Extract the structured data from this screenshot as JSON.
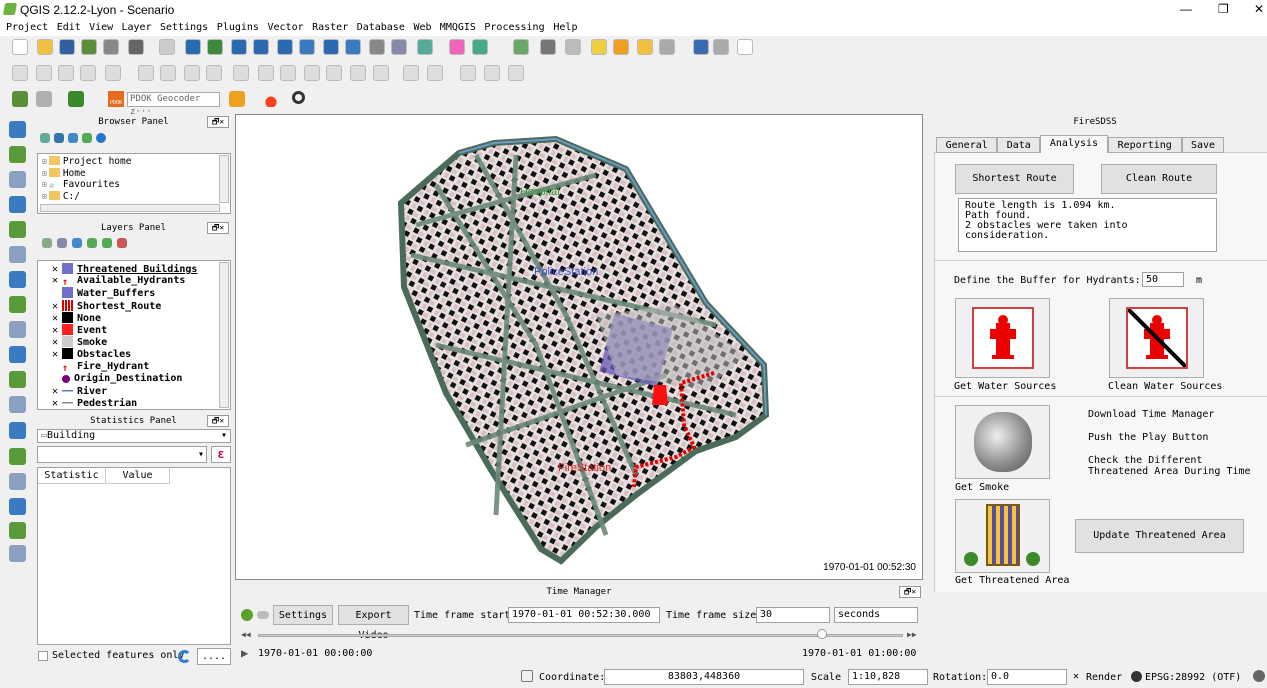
{
  "window": {
    "title": "QGIS 2.12.2-Lyon - Scenario",
    "min": "—",
    "max": "❐",
    "close": "✕"
  },
  "menu": [
    "Project",
    "Edit",
    "View",
    "Layer",
    "Settings",
    "Plugins",
    "Vector",
    "Raster",
    "Database",
    "Web",
    "MMQGIS",
    "Processing",
    "Help"
  ],
  "toolbar3": {
    "geocoder_placeholder": "PDOK Geocoder z···",
    "pdok_label": "PDOK"
  },
  "browser": {
    "title": "Browser Panel",
    "items": [
      "Project home",
      "Home",
      "Favourites",
      "C:/"
    ]
  },
  "layers": {
    "title": "Layers Panel",
    "items": [
      {
        "name": "Threatened Buildings",
        "checked": "✕",
        "color": "#7070c8",
        "underline": true
      },
      {
        "name": "Available_Hydrants",
        "checked": "✕",
        "color": "#e00000",
        "type": "hydrant"
      },
      {
        "name": "Water_Buffers",
        "checked": "",
        "color": "#7070c8"
      },
      {
        "name": "Shortest_Route",
        "checked": "✕",
        "color": "#e00000",
        "type": "route"
      },
      {
        "name": "None",
        "checked": "✕",
        "color": "#000000"
      },
      {
        "name": "Event",
        "checked": "✕",
        "color": "#ff2020"
      },
      {
        "name": "Smoke",
        "checked": "✕",
        "color": "#cccccc"
      },
      {
        "name": "Obstacles",
        "checked": "✕",
        "color": "#000000"
      },
      {
        "name": "Fire_Hydrant",
        "checked": "",
        "color": "#e00000",
        "type": "hydrant"
      },
      {
        "name": "Origin_Destination",
        "checked": "",
        "color": "#800080",
        "type": "dot"
      },
      {
        "name": "River",
        "checked": "✕",
        "color": "#5080c0",
        "type": "line"
      },
      {
        "name": "Pedestrian",
        "checked": "✕",
        "color": "#888888",
        "type": "line"
      }
    ]
  },
  "stats": {
    "title": "Statistics Panel",
    "layer": "Building",
    "col1": "Statistic",
    "col2": "Value",
    "expr": "ε",
    "selected": "Selected features only",
    "more": "...."
  },
  "map": {
    "timestamp": "1970-01-01 00:52:30",
    "labels": {
      "hospital": "Hospital",
      "police": "PoliceStation",
      "fire": "FireStation"
    }
  },
  "time": {
    "title": "Time Manager",
    "settings": "Settings",
    "export": "Export Video",
    "start_label": "Time frame start:",
    "start_value": "1970-01-01 00:52:30.000",
    "size_label": "Time frame size:",
    "size_value": "30",
    "unit": "seconds",
    "t0": "1970-01-01 00:00:00",
    "t1": "1970-01-01 01:00:00",
    "slider_fraction": 0.875
  },
  "fire": {
    "title": "FireSDSS",
    "tabs": [
      "General",
      "Data",
      "Analysis",
      "Reporting",
      "Save"
    ],
    "active_tab": "Analysis",
    "shortest": "Shortest Route",
    "clean": "Clean Route",
    "log": [
      "Route length is 1.094 km.",
      "Path found.",
      "2 obstacles were taken into consideration."
    ],
    "buffer_label": "Define the Buffer for Hydrants:",
    "buffer_value": "50",
    "buffer_unit": "m",
    "get_water": "Get Water Sources",
    "clean_water": "Clean Water Sources",
    "step1": "Download Time Manager",
    "step2": "Push the Play Button",
    "step3": "Check the Different Threatened Area During Time",
    "get_smoke": "Get Smoke",
    "update": "Update Threatened Area",
    "get_threat": "Get Threatened Area"
  },
  "status": {
    "coord_label": "Coordinate:",
    "coord_value": "83803,448360",
    "scale_label": "Scale",
    "scale_value": "1:10,828",
    "rot_label": "Rotation:",
    "rot_value": "0.0",
    "render": "Render",
    "crs": "EPSG:28992 (OTF)"
  }
}
